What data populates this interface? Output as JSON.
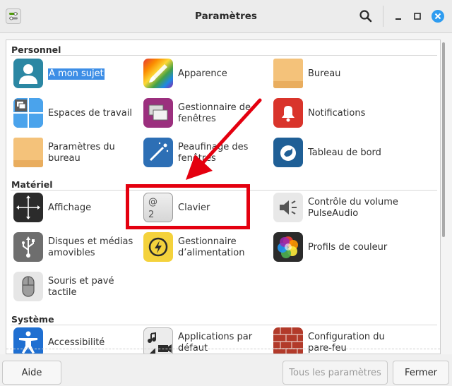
{
  "window": {
    "title": "Paramètres"
  },
  "categories": [
    {
      "title": "Personnel",
      "items": [
        {
          "label": "À mon sujet",
          "icon": "user-icon",
          "selected": true
        },
        {
          "label": "Apparence",
          "icon": "paintbrush-icon"
        },
        {
          "label": "Bureau",
          "icon": "folder-icon"
        },
        {
          "label": "Espaces de travail",
          "icon": "workspaces-icon"
        },
        {
          "label": "Gestionnaire de fenêtres",
          "icon": "windows-icon"
        },
        {
          "label": "Notifications",
          "icon": "bell-icon"
        },
        {
          "label": "Paramètres du bureau",
          "icon": "folder-icon"
        },
        {
          "label": "Peaufinage des fenêtres",
          "icon": "magic-wand-icon"
        },
        {
          "label": "Tableau de bord",
          "icon": "panel-icon"
        }
      ]
    },
    {
      "title": "Matériel",
      "items": [
        {
          "label": "Affichage",
          "icon": "display-arrows-icon"
        },
        {
          "label": "Clavier",
          "icon": "keyboard-key-icon",
          "key_top": "@",
          "key_bottom": "2"
        },
        {
          "label": "Contrôle du volume PulseAudio",
          "icon": "speaker-icon"
        },
        {
          "label": "Disques et médias amovibles",
          "icon": "usb-icon"
        },
        {
          "label": "Gestionnaire d’alimentation",
          "icon": "power-icon"
        },
        {
          "label": "Profils de couleur",
          "icon": "color-wheel-icon"
        },
        {
          "label": "Souris et pavé tactile",
          "icon": "mouse-icon"
        }
      ]
    },
    {
      "title": "Système",
      "items": [
        {
          "label": "Accessibilité",
          "icon": "accessibility-icon"
        },
        {
          "label": "Applications par défaut",
          "icon": "default-apps-icon"
        },
        {
          "label": "Configuration du pare-feu",
          "icon": "firewall-icon"
        }
      ]
    }
  ],
  "footer": {
    "help_label": "Aide",
    "all_settings_label": "Tous les paramètres",
    "close_label": "Fermer"
  },
  "colors": {
    "accent": "#3d8ee6",
    "annotation": "#e4000f",
    "close_button": "#2e9cf0"
  }
}
